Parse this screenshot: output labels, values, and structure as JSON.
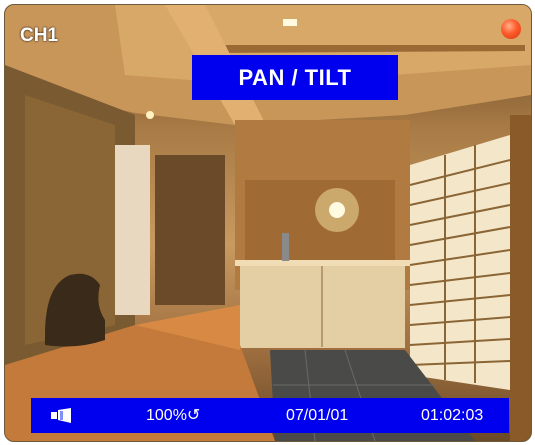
{
  "channel": {
    "label": "CH1"
  },
  "mode": {
    "label": "PAN / TILT"
  },
  "status": {
    "zoom": "100%",
    "refresh_glyph": "↺",
    "date": "07/01/01",
    "time": "01:02:03",
    "camera_icon": "camera-icon"
  },
  "colors": {
    "banner": "#0000ee",
    "record_dot": "#ff5a2a",
    "text": "#ffffff"
  }
}
